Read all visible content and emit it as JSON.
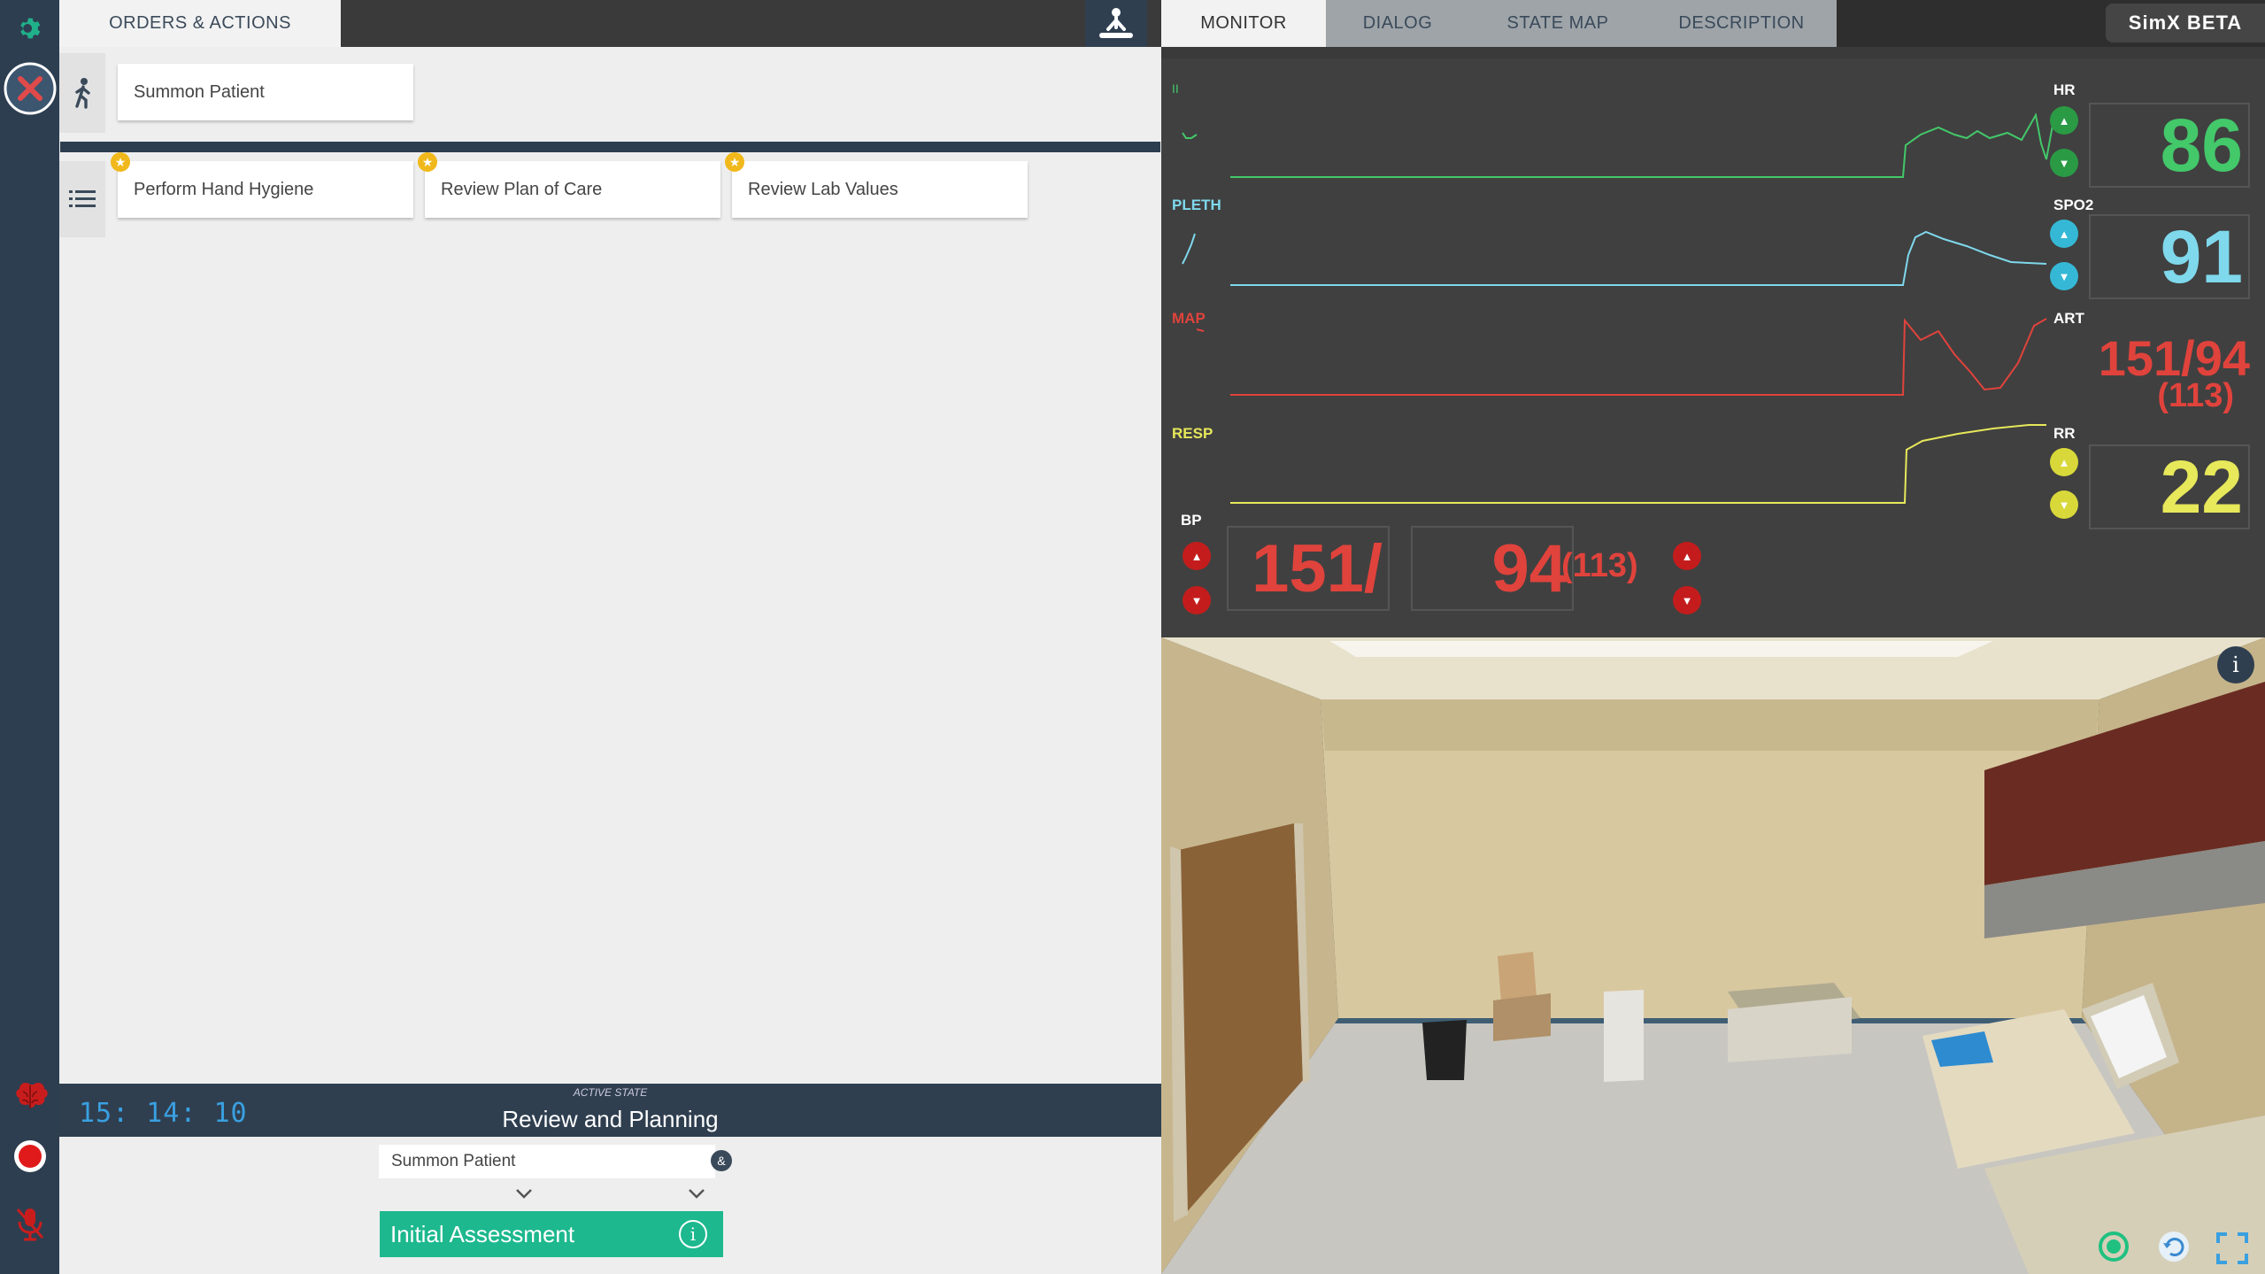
{
  "left_rail": {
    "icons": [
      "gear-icon",
      "close-icon",
      "brain-icon",
      "record-icon",
      "mute-icon"
    ]
  },
  "orders": {
    "tab_label": "ORDERS & ACTIONS",
    "patient_row": {
      "icon": "walking-person-icon",
      "action": "Summon Patient"
    },
    "actions_row": {
      "icon": "list-icon",
      "actions": [
        {
          "label": "Perform Hand Hygiene",
          "starred": true
        },
        {
          "label": "Review Plan of Care",
          "starred": true
        },
        {
          "label": "Review Lab Values",
          "starred": true
        }
      ]
    },
    "cpr_icon": "cpr-icon"
  },
  "state": {
    "clock": "15: 14: 10",
    "active_label": "ACTIVE STATE",
    "name": "Review and Planning",
    "transition": "Summon Patient",
    "transition_badge": "&",
    "next_state": "Initial Assessment",
    "next_info": "i"
  },
  "tabs": {
    "items": [
      "MONITOR",
      "DIALOG",
      "STATE MAP",
      "DESCRIPTION"
    ],
    "active": "MONITOR",
    "brand": "SimX BETA"
  },
  "monitor": {
    "channels": [
      {
        "label": "II",
        "color": "#43c86a"
      },
      {
        "label": "PLETH",
        "color": "#7fd8ec"
      },
      {
        "label": "MAP",
        "color": "#e0433c"
      },
      {
        "label": "RESP",
        "color": "#e7e85a"
      }
    ],
    "vitals": {
      "hr": {
        "label": "HR",
        "value": "86",
        "color": "#43c86a"
      },
      "spo2": {
        "label": "SPO2",
        "value": "91",
        "color": "#7fd8ec"
      },
      "art": {
        "label": "ART",
        "value": "151/94",
        "mean": "(113)",
        "color": "#e0433c"
      },
      "rr": {
        "label": "RR",
        "value": "22",
        "color": "#e7e85a"
      }
    },
    "bp": {
      "label": "BP",
      "systolic": "151/",
      "diastolic": "94",
      "mean": "(113)",
      "color": "#e0433c"
    }
  },
  "scene": {
    "info": "i",
    "controls": [
      "refresh-icon",
      "undo-icon",
      "fullscreen-icon"
    ]
  }
}
